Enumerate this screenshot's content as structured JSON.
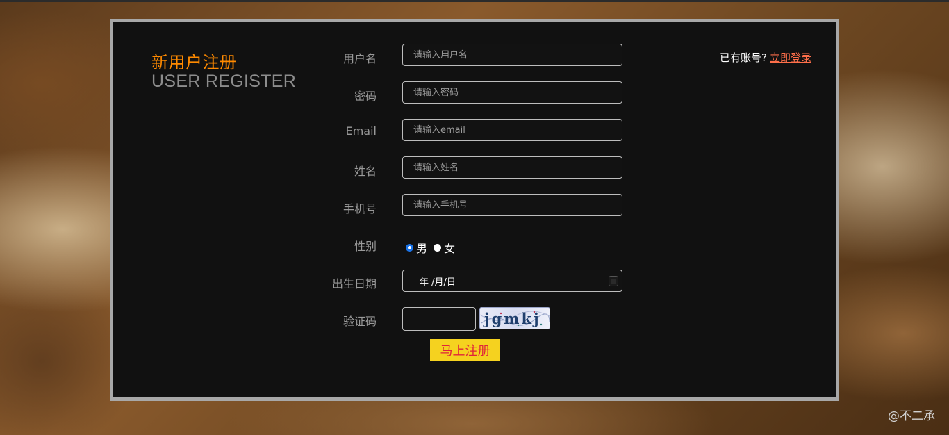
{
  "header": {
    "title_cn": "新用户注册",
    "title_en": "USER REGISTER"
  },
  "login_hint": {
    "text": "已有账号?",
    "link": "立即登录"
  },
  "form": {
    "username": {
      "label": "用户名",
      "placeholder": "请输入用户名",
      "value": ""
    },
    "password": {
      "label": "密码",
      "placeholder": "请输入密码",
      "value": ""
    },
    "email": {
      "label": "Email",
      "placeholder": "请输入email",
      "value": ""
    },
    "name": {
      "label": "姓名",
      "placeholder": "请输入姓名",
      "value": ""
    },
    "phone": {
      "label": "手机号",
      "placeholder": "请输入手机号",
      "value": ""
    },
    "gender": {
      "label": "性别",
      "options": [
        "男",
        "女"
      ],
      "selected": "男"
    },
    "birthday": {
      "label": "出生日期",
      "display": "年 /月/日"
    },
    "captcha": {
      "label": "验证码",
      "value": "",
      "image_text": "jgmkj"
    },
    "submit_label": "马上注册"
  },
  "watermark": "@不二承",
  "colors": {
    "accent_orange": "#ff8a00",
    "link": "#ff6f4a",
    "button_bg": "#f5d21f",
    "button_text": "#e0243a",
    "panel_bg": "#111111"
  }
}
